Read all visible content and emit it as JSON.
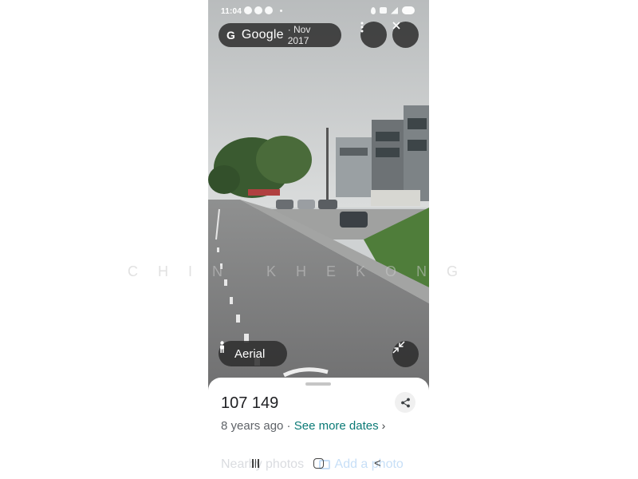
{
  "status_bar": {
    "time": "11:04",
    "battery": "86"
  },
  "header": {
    "brand": "Google",
    "date": "· Nov 2017"
  },
  "buttons": {
    "more_icon": "more-vert-icon",
    "close_icon": "close-icon",
    "collapse_icon": "collapse-icon"
  },
  "mode_pill": {
    "label": "Aerial",
    "icon": "pegman-icon"
  },
  "sheet": {
    "plus_code": "107 149",
    "age": "8 years ago",
    "separator": " · ",
    "see_more": "See more dates",
    "nearby": "Nearby photos",
    "add_photo": "Add a photo"
  },
  "watermark": "CHIN KHEKONG",
  "colors": {
    "accent": "#0b7a76",
    "overlay": "#2d2d2d"
  }
}
